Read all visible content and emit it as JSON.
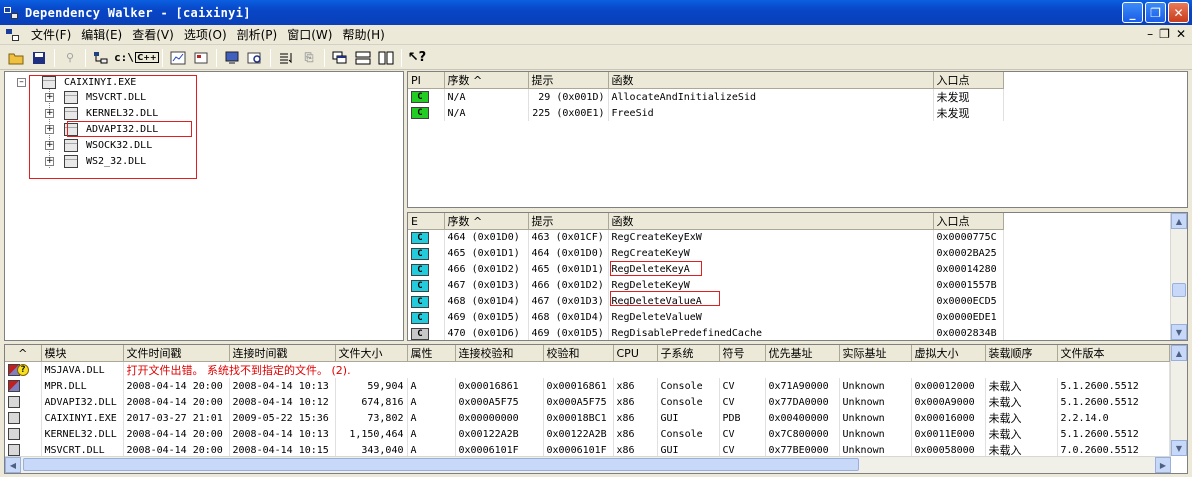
{
  "window": {
    "title": "Dependency Walker - [caixinyi]"
  },
  "menu": [
    "文件(F)",
    "编辑(E)",
    "查看(V)",
    "选项(O)",
    "剖析(P)",
    "窗口(W)",
    "帮助(H)"
  ],
  "toolbar": {
    "c_drive_label": "c:\\",
    "cpp_label": "C++"
  },
  "tree": {
    "root": "CAIXINYI.EXE",
    "children": [
      "MSVCRT.DLL",
      "KERNEL32.DLL",
      "ADVAPI32.DLL",
      "WSOCK32.DLL",
      "WS2_32.DLL"
    ]
  },
  "imports": {
    "headers": [
      "PI",
      "序数 ^",
      "提示",
      "函数",
      "入口点"
    ],
    "rows": [
      {
        "icon": "C",
        "ordinal": "N/A",
        "hint": "29  (0x001D)",
        "function": "AllocateAndInitializeSid",
        "entry": "未发现"
      },
      {
        "icon": "C",
        "ordinal": "N/A",
        "hint": "225  (0x00E1)",
        "function": "FreeSid",
        "entry": "未发现"
      }
    ]
  },
  "exports": {
    "headers": [
      "E",
      "序数 ^",
      "提示",
      "函数",
      "入口点"
    ],
    "rows": [
      {
        "icon": "C",
        "icon_color": "cyan",
        "ordinal": "464  (0x01D0)",
        "hint": "463  (0x01CF)",
        "function": "RegCreateKeyExW",
        "entry": "0x0000775C"
      },
      {
        "icon": "C",
        "icon_color": "cyan",
        "ordinal": "465  (0x01D1)",
        "hint": "464  (0x01D0)",
        "function": "RegCreateKeyW",
        "entry": "0x0002BA25"
      },
      {
        "icon": "C",
        "icon_color": "cyan",
        "ordinal": "466  (0x01D2)",
        "hint": "465  (0x01D1)",
        "function": "RegDeleteKeyA",
        "entry": "0x00014280"
      },
      {
        "icon": "C",
        "icon_color": "cyan",
        "ordinal": "467  (0x01D3)",
        "hint": "466  (0x01D2)",
        "function": "RegDeleteKeyW",
        "entry": "0x0001557B"
      },
      {
        "icon": "C",
        "icon_color": "cyan",
        "ordinal": "468  (0x01D4)",
        "hint": "467  (0x01D3)",
        "function": "RegDeleteValueA",
        "entry": "0x0000ECD5"
      },
      {
        "icon": "C",
        "icon_color": "cyan",
        "ordinal": "469  (0x01D5)",
        "hint": "468  (0x01D4)",
        "function": "RegDeleteValueW",
        "entry": "0x0000EDE1"
      },
      {
        "icon": "C",
        "icon_color": "gray",
        "ordinal": "470  (0x01D6)",
        "hint": "469  (0x01D5)",
        "function": "RegDisablePredefinedCache",
        "entry": "0x0002834B"
      }
    ]
  },
  "modules": {
    "headers": [
      "^",
      "模块",
      "文件时间戳",
      "连接时间戳",
      "文件大小",
      "属性",
      "连接校验和",
      "校验和",
      "CPU",
      "子系统",
      "符号",
      "优先基址",
      "实际基址",
      "虚拟大小",
      "装载顺序",
      "文件版本"
    ],
    "error_row": {
      "module": "MSJAVA.DLL",
      "message": "打开文件出错。 系统找不到指定的文件。 (2)."
    },
    "rows": [
      {
        "module": "MPR.DLL",
        "file_time": "2008-04-14 20:00",
        "link_time": "2008-04-14 10:13",
        "size": "59,904",
        "attr": "A",
        "link_checksum": "0x00016861",
        "checksum": "0x00016861",
        "cpu": "x86",
        "subsystem": "Console",
        "symbols": "CV",
        "pref_base": "0x71A90000",
        "actual_base": "Unknown",
        "virt_size": "0x00012000",
        "load_order": "未载入",
        "version": "5.1.2600.5512"
      },
      {
        "module": "ADVAPI32.DLL",
        "file_time": "2008-04-14 20:00",
        "link_time": "2008-04-14 10:12",
        "size": "674,816",
        "attr": "A",
        "link_checksum": "0x000A5F75",
        "checksum": "0x000A5F75",
        "cpu": "x86",
        "subsystem": "Console",
        "symbols": "CV",
        "pref_base": "0x77DA0000",
        "actual_base": "Unknown",
        "virt_size": "0x000A9000",
        "load_order": "未载入",
        "version": "5.1.2600.5512"
      },
      {
        "module": "CAIXINYI.EXE",
        "file_time": "2017-03-27 21:01",
        "link_time": "2009-05-22 15:36",
        "size": "73,802",
        "attr": "A",
        "link_checksum": "0x00000000",
        "checksum": "0x00018BC1",
        "cpu": "x86",
        "subsystem": "GUI",
        "symbols": "PDB",
        "pref_base": "0x00400000",
        "actual_base": "Unknown",
        "virt_size": "0x00016000",
        "load_order": "未载入",
        "version": "2.2.14.0"
      },
      {
        "module": "KERNEL32.DLL",
        "file_time": "2008-04-14 20:00",
        "link_time": "2008-04-14 10:13",
        "size": "1,150,464",
        "attr": "A",
        "link_checksum": "0x00122A2B",
        "checksum": "0x00122A2B",
        "cpu": "x86",
        "subsystem": "Console",
        "symbols": "CV",
        "pref_base": "0x7C800000",
        "actual_base": "Unknown",
        "virt_size": "0x0011E000",
        "load_order": "未载入",
        "version": "5.1.2600.5512"
      },
      {
        "module": "MSVCRT.DLL",
        "file_time": "2008-04-14 20:00",
        "link_time": "2008-04-14 10:15",
        "size": "343,040",
        "attr": "A",
        "link_checksum": "0x0006101F",
        "checksum": "0x0006101F",
        "cpu": "x86",
        "subsystem": "GUI",
        "symbols": "CV",
        "pref_base": "0x77BE0000",
        "actual_base": "Unknown",
        "virt_size": "0x00058000",
        "load_order": "未载入",
        "version": "7.0.2600.5512"
      }
    ]
  },
  "colors": {
    "title_bar": "#0846c6",
    "highlight_box": "#e02020",
    "error_text": "#e00000",
    "import_icon": "#22cc22",
    "export_icon": "#22ccdd"
  }
}
